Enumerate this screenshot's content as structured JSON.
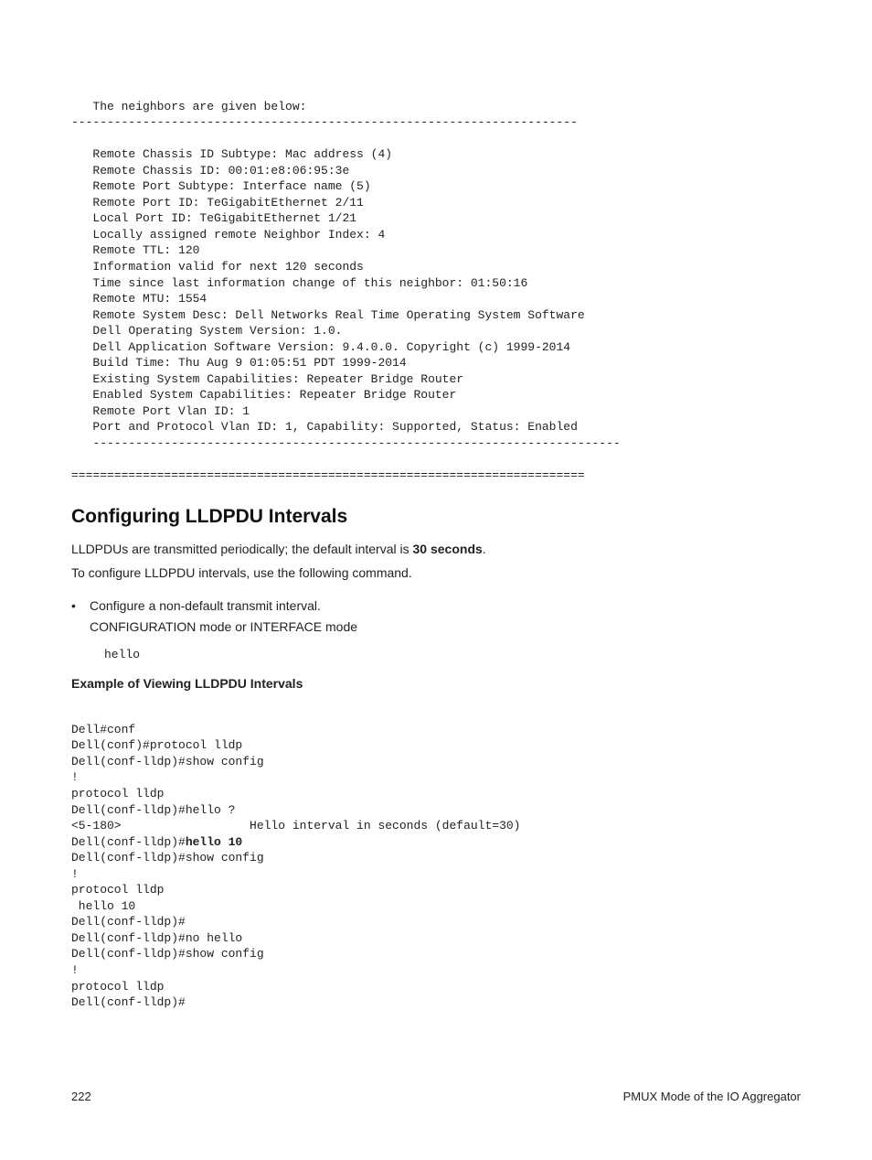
{
  "code1_line0": "   The neighbors are given below:",
  "code1_line1": "-----------------------------------------------------------------------",
  "code1_line2": "",
  "code1_line3": "   Remote Chassis ID Subtype: Mac address (4)",
  "code1_line4": "   Remote Chassis ID: 00:01:e8:06:95:3e",
  "code1_line5": "   Remote Port Subtype: Interface name (5)",
  "code1_line6": "   Remote Port ID: TeGigabitEthernet 2/11",
  "code1_line7": "   Local Port ID: TeGigabitEthernet 1/21",
  "code1_line8": "   Locally assigned remote Neighbor Index: 4",
  "code1_line9": "   Remote TTL: 120",
  "code1_line10": "   Information valid for next 120 seconds",
  "code1_line11": "   Time since last information change of this neighbor: 01:50:16",
  "code1_line12": "   Remote MTU: 1554",
  "code1_line13": "   Remote System Desc: Dell Networks Real Time Operating System Software",
  "code1_line14": "   Dell Operating System Version: 1.0.",
  "code1_line15": "   Dell Application Software Version: 9.4.0.0. Copyright (c) 1999-2014",
  "code1_line16": "   Build Time: Thu Aug 9 01:05:51 PDT 1999-2014",
  "code1_line17": "   Existing System Capabilities: Repeater Bridge Router",
  "code1_line18": "   Enabled System Capabilities: Repeater Bridge Router",
  "code1_line19": "   Remote Port Vlan ID: 1",
  "code1_line20": "   Port and Protocol Vlan ID: 1, Capability: Supported, Status: Enabled",
  "code1_line21": "   -------------------------------------------------------------------------- ",
  "code1_line22": "",
  "code1_line23": "========================================================================",
  "section_heading": "Configuring LLDPDU Intervals",
  "intro_pre": "LLDPDUs are transmitted periodically; the default interval is ",
  "intro_bold": "30 seconds",
  "intro_post": ".",
  "intro_line2": "To configure LLDPDU intervals, use the following command.",
  "bullet_line1": "Configure a non-default transmit interval.",
  "bullet_line2": "CONFIGURATION mode or INTERFACE mode",
  "inline_code": "hello",
  "example_heading": "Example of Viewing LLDPDU Intervals",
  "code2_line0": "Dell#conf",
  "code2_line1": "Dell(conf)#protocol lldp",
  "code2_line2": "Dell(conf-lldp)#show config",
  "code2_line3": "!",
  "code2_line4": "protocol lldp",
  "code2_line5": "Dell(conf-lldp)#hello ?",
  "code2_line6": "<5-180>                  Hello interval in seconds (default=30)",
  "code2_line7a": "Dell(conf-lldp)#",
  "code2_line7b": "hello 10",
  "code2_line8": "Dell(conf-lldp)#show config",
  "code2_line9": "!",
  "code2_line10": "protocol lldp",
  "code2_line11": " hello 10",
  "code2_line12": "Dell(conf-lldp)#",
  "code2_line13": "Dell(conf-lldp)#no hello",
  "code2_line14": "Dell(conf-lldp)#show config",
  "code2_line15": "!",
  "code2_line16": "protocol lldp",
  "code2_line17": "Dell(conf-lldp)#",
  "footer_page": "222",
  "footer_title": "PMUX Mode of the IO Aggregator"
}
